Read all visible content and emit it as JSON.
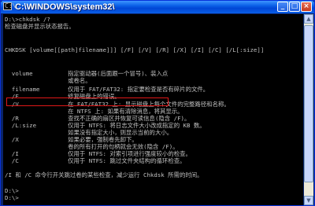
{
  "window": {
    "title": "C:\\WINDOWS\\system32\\",
    "minimize": "_",
    "maximize": "□",
    "close": "×"
  },
  "console": {
    "lines": [
      "D:\\>chkdsk /?",
      "检查磁盘并显示状态报告。",
      "",
      "",
      "CHKDSK [volume[[path]filename]]] [/F] [/V] [/R] [/X] [/I] [/C] [/L[:size]]",
      "",
      "",
      "  volume          指定驱动器(后面跟一个冒号)、装入点",
      "                  或卷名。",
      "  filename        仅用于 FAT/FAT32: 指定要检查是否有碎片的文件。",
      "  /F              修复磁盘上的错误。",
      "  /V              在 FAT/FAT32 上: 显示磁盘上每个文件的完整路径和名称。",
      "                  在 NTFS 上: 如果有清除消息，将其显示。",
      "  /R              查找不正确的扇区并恢复可读信息(隐含 /F)。",
      "  /L:size         仅用于 NTFS: 将日志文件大小改成指定的 KB 数。",
      "                  如果没有指定大小，则显示当前的大小。",
      "  /X              如果必要，强制卷先卸下。",
      "                  卷的所有打开的句柄就会无效(隐含 /F)。",
      "  /I              仅用于 NTFS: 对索引项进行强度较小的检查。",
      "  /C              仅用于 NTFS: 跳过文件夹结构的循环检查。",
      "",
      "/I 和 /C 命令行开关跳过卷的某些检查，减少运行 Chkdsk 所需的时间。",
      "",
      "D:\\>",
      "D:\\>"
    ]
  },
  "scrollbar": {
    "up": "▲",
    "down": "▼"
  }
}
